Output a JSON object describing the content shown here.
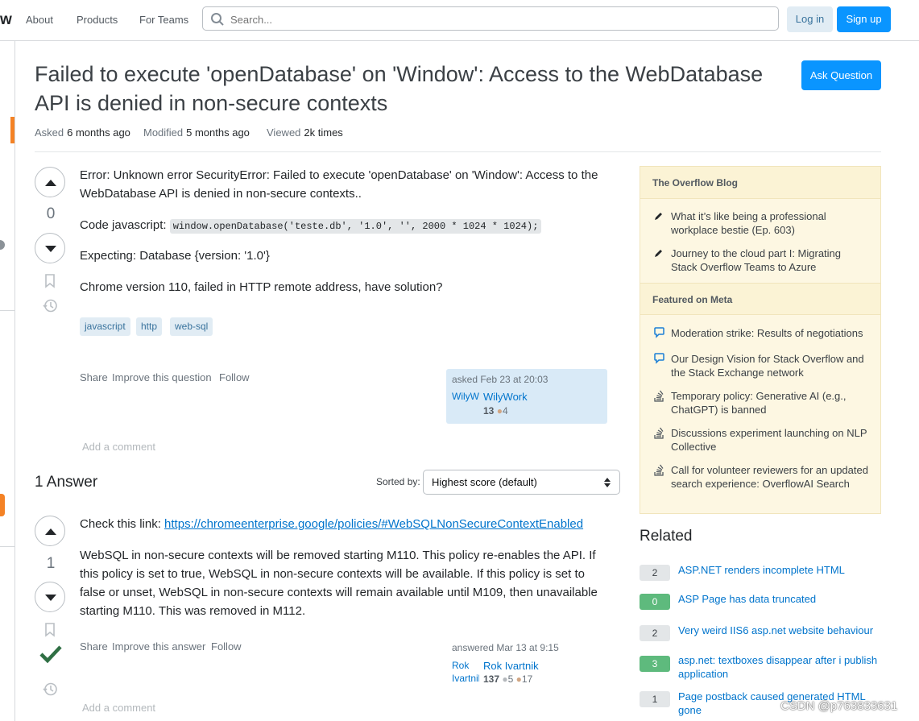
{
  "topbar": {
    "logo_fragment": "w",
    "nav": [
      "About",
      "Products",
      "For Teams"
    ],
    "search_placeholder": "Search...",
    "login": "Log in",
    "signup": "Sign up"
  },
  "question": {
    "title": "Failed to execute 'openDatabase' on 'Window': Access to the WebDatabase API is denied in non-secure contexts",
    "ask_button": "Ask Question",
    "meta": {
      "asked_label": "Asked",
      "asked_value": "6 months ago",
      "modified_label": "Modified",
      "modified_value": "5 months ago",
      "viewed_label": "Viewed",
      "viewed_value": "2k times"
    },
    "votes": "0",
    "body": {
      "p1": "Error: Unknown error SecurityError: Failed to execute 'openDatabase' on 'Window': Access to the WebDatabase API is denied in non-secure contexts..",
      "p2_prefix": "Code javascript: ",
      "p2_code": "window.openDatabase('teste.db', '1.0', '', 2000 * 1024 * 1024);",
      "p3": "Expecting: Database {version: '1.0'}",
      "p4": "Chrome version 110, failed in HTTP remote address, have solution?"
    },
    "tags": [
      "javascript",
      "http",
      "web-sql"
    ],
    "menu": {
      "share": "Share",
      "improve": "Improve this question",
      "follow": "Follow"
    },
    "asked_card": {
      "time": "asked Feb 23 at 20:03",
      "avatar_alt": "WilyWork",
      "user": "WilyWork",
      "rep": "13",
      "bronze": "4"
    },
    "add_comment": "Add a comment"
  },
  "answers": {
    "heading": "1 Answer",
    "sort_label": "Sorted by:",
    "sort_value": "Highest score (default)",
    "items": [
      {
        "votes": "1",
        "p1_prefix": "Check this link: ",
        "p1_link": "https://chromeenterprise.google/policies/#WebSQLNonSecureContextEnabled",
        "p2": "WebSQL in non-secure contexts will be removed starting M110. This policy re-enables the API. If this policy is set to true, WebSQL in non-secure contexts will be available. If this policy is set to false or unset, WebSQL in non-secure contexts will remain available until M109, then unavailable starting M110. This was removed in M112.",
        "menu": {
          "share": "Share",
          "improve": "Improve this answer",
          "follow": "Follow"
        },
        "card": {
          "time": "answered Mar 13 at 9:15",
          "avatar_alt": "Rok Ivartnik",
          "user": "Rok Ivartnik",
          "rep": "137",
          "silver": "5",
          "bronze": "17"
        },
        "add_comment": "Add a comment"
      }
    ]
  },
  "sidebar": {
    "blog_heading": "The Overflow Blog",
    "blog_items": [
      "What it’s like being a professional workplace bestie (Ep. 603)",
      "Journey to the cloud part I: Migrating Stack Overflow Teams to Azure"
    ],
    "meta_heading": "Featured on Meta",
    "meta_items": [
      "Moderation strike: Results of negotiations",
      "Our Design Vision for Stack Overflow and the Stack Exchange network",
      "Temporary policy: Generative AI (e.g., ChatGPT) is banned",
      "Discussions experiment launching on NLP Collective",
      "Call for volunteer reviewers for an updated search experience: OverflowAI Search"
    ],
    "related_heading": "Related",
    "related": [
      {
        "score": "2",
        "title": "ASP.NET renders incomplete HTML",
        "accepted": false
      },
      {
        "score": "0",
        "title": "ASP Page has data truncated",
        "accepted": true
      },
      {
        "score": "2",
        "title": "Very weird IIS6 asp.net website behaviour",
        "accepted": false
      },
      {
        "score": "3",
        "title": "asp.net: textboxes disappear after i publish application",
        "accepted": true
      },
      {
        "score": "1",
        "title": "Page postback caused generated HTML gone",
        "accepted": false
      }
    ]
  },
  "watermark": "CSDN @p763833631",
  "colors": {
    "accent": "#0a95ff",
    "link": "#0074cc",
    "accepted": "#2f6f44",
    "sidebar_bg": "#fdf7e2"
  }
}
